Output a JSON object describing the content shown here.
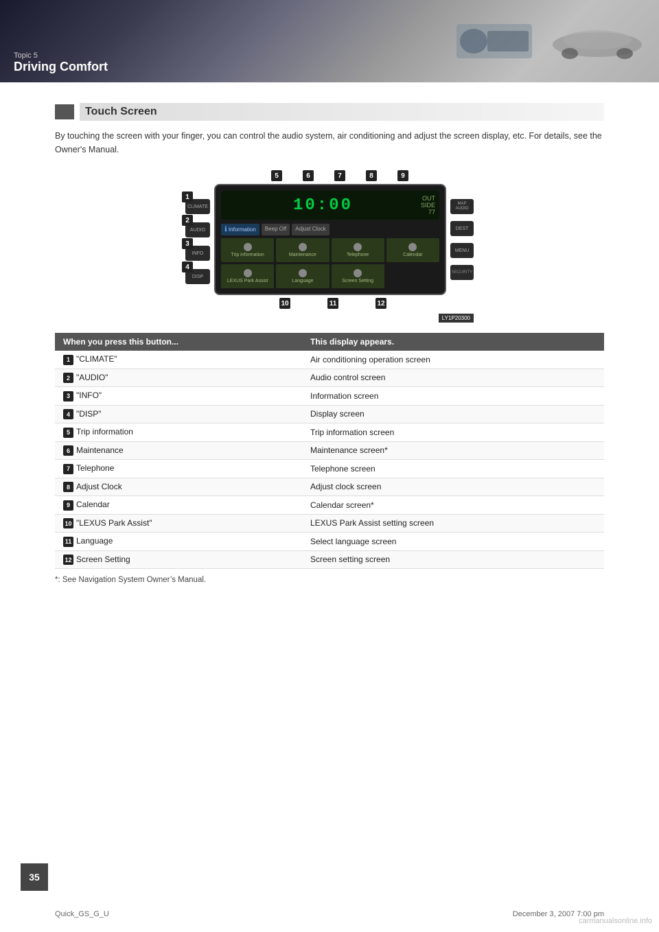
{
  "banner": {
    "topic_label": "Topic 5",
    "title": "Driving Comfort"
  },
  "section": {
    "title": "Touch Screen",
    "description": "By touching the screen with your finger, you can control the audio system, air conditioning and adjust the screen display, etc. For details, see the Owner's Manual."
  },
  "table": {
    "col1_header": "When you press this button...",
    "col2_header": "This display appears.",
    "rows": [
      {
        "badge": "1",
        "button": "\"CLIMATE\"",
        "display": "Air conditioning operation screen"
      },
      {
        "badge": "2",
        "button": "\"AUDIO\"",
        "display": "Audio control screen"
      },
      {
        "badge": "3",
        "button": "\"INFO\"",
        "display": "Information screen"
      },
      {
        "badge": "4",
        "button": "\"DISP\"",
        "display": "Display screen"
      },
      {
        "badge": "5",
        "button": "Trip information",
        "display": "Trip information screen"
      },
      {
        "badge": "6",
        "button": "Maintenance",
        "display": "Maintenance screen*"
      },
      {
        "badge": "7",
        "button": "Telephone",
        "display": "Telephone screen"
      },
      {
        "badge": "8",
        "button": "Adjust Clock",
        "display": "Adjust clock screen"
      },
      {
        "badge": "9",
        "button": "Calendar",
        "display": "Calendar screen*"
      },
      {
        "badge": "10",
        "button": "\"LEXUS Park Assist\"",
        "display": "LEXUS Park Assist setting screen"
      },
      {
        "badge": "11",
        "button": "Language",
        "display": "Select language screen"
      },
      {
        "badge": "12",
        "button": "Screen Setting",
        "display": "Screen setting screen"
      }
    ]
  },
  "footnote": "*: See Navigation System Owner’s Manual.",
  "screen_time": "10:00",
  "screen_labels": {
    "info": "Information",
    "beep_off": "Beep Off",
    "adjust_clock": "Adjust Clock",
    "trip": "Trip information",
    "maintenance": "Maintenance",
    "telephone": "Telephone",
    "calendar": "Calendar",
    "lexus": "LEXUS Park Assist",
    "language": "Language",
    "screen_setting": "Screen Setting"
  },
  "side_buttons": {
    "left": [
      "CLIMATE",
      "AUDIO",
      "INFO",
      "DISP"
    ],
    "right": [
      "MAP AUDIO",
      "DEST",
      "MENU",
      "SECURITY"
    ]
  },
  "top_badges": [
    "5",
    "6",
    "7",
    "8",
    "9"
  ],
  "bottom_badges": [
    "10",
    "11",
    "12"
  ],
  "page_number": "35",
  "footer": {
    "left": "Quick_GS_G_U",
    "right": "December 3, 2007 7:00 pm"
  },
  "img_ref": "LY1P20300",
  "watermark": "carmanualsonline.info"
}
